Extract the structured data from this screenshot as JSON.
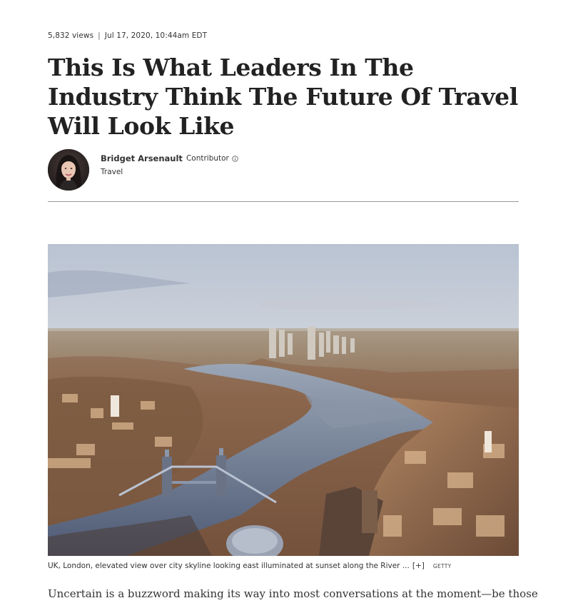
{
  "article": {
    "views": "5,832 views",
    "separator": "|",
    "date": "Jul 17, 2020, 10:44am EDT",
    "headline": "This Is What Leaders In The Industry Think The Future Of Travel Will Look Like",
    "author": {
      "name": "Bridget Arsenault",
      "role": "Contributor",
      "channel": "Travel"
    },
    "image": {
      "caption": "UK, London, elevated view over city skyline looking east illuminated at sunset along the River ...",
      "expand_label": "[+]",
      "credit": "GETTY"
    },
    "body_first_line": "Uncertain is a buzzword making its way into most conversations at the moment—be those"
  },
  "icons": {
    "info": "info-circle-icon"
  },
  "colors": {
    "text": "#333333",
    "headline": "#222222",
    "divider": "#999999",
    "background": "#ffffff"
  }
}
